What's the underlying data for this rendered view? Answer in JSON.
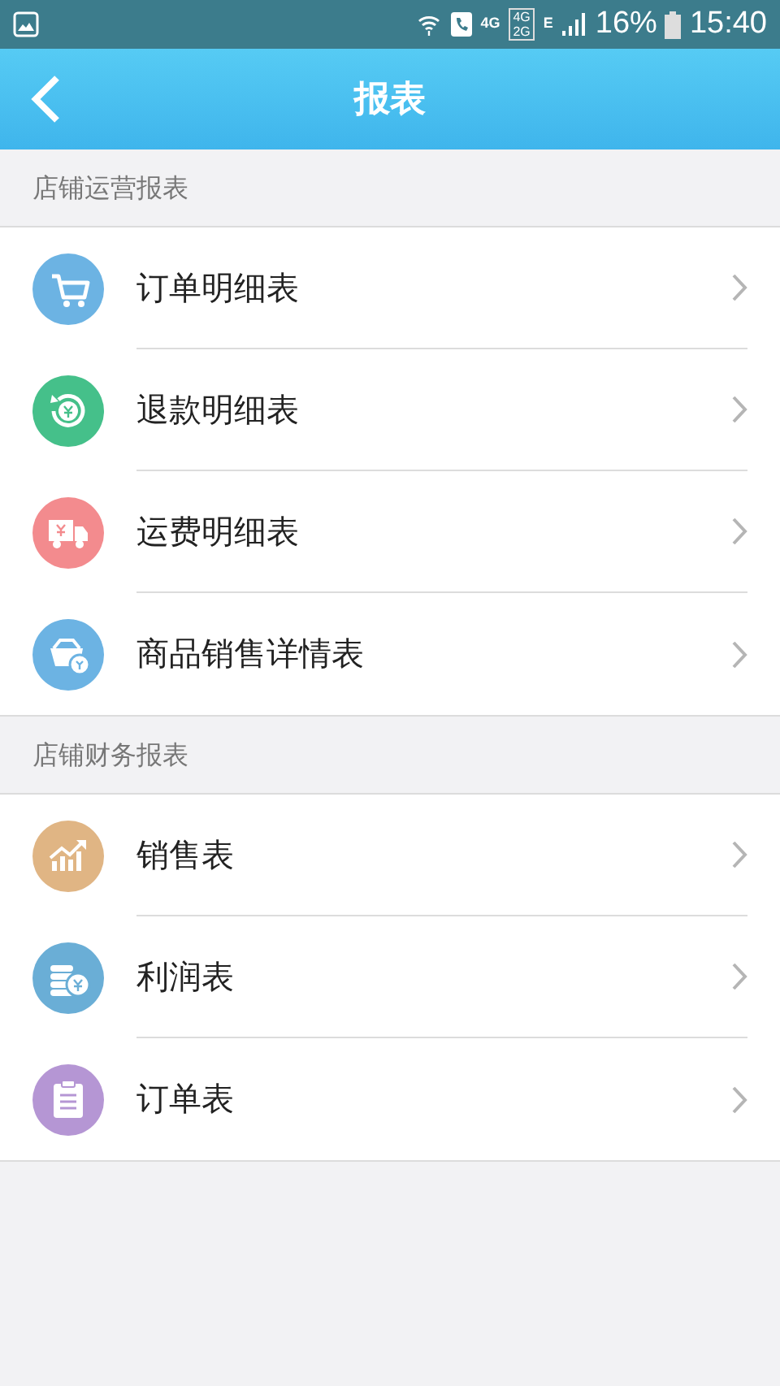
{
  "status_bar": {
    "network_labels": [
      "4G",
      "4G",
      "2G",
      "E"
    ],
    "battery": "16%",
    "time": "15:40"
  },
  "header": {
    "title": "报表"
  },
  "sections": [
    {
      "title": "店铺运营报表",
      "items": [
        {
          "label": "订单明细表",
          "kind": "cart",
          "color": "#6cb3e3"
        },
        {
          "label": "退款明细表",
          "kind": "refund",
          "color": "#45c08a"
        },
        {
          "label": "运费明细表",
          "kind": "truck",
          "color": "#f38b8e"
        },
        {
          "label": "商品销售详情表",
          "kind": "basket",
          "color": "#6cb3e3"
        }
      ]
    },
    {
      "title": "店铺财务报表",
      "items": [
        {
          "label": "销售表",
          "kind": "chart",
          "color": "#e0b584"
        },
        {
          "label": "利润表",
          "kind": "coins",
          "color": "#6aaed6"
        },
        {
          "label": "订单表",
          "kind": "clipboard",
          "color": "#b596d4"
        }
      ]
    }
  ]
}
